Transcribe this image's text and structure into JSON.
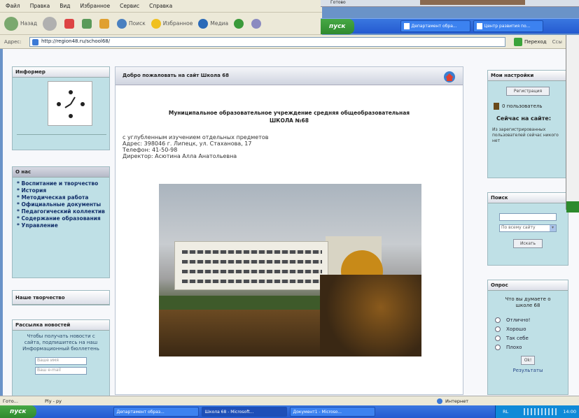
{
  "menu": [
    "Файл",
    "Правка",
    "Вид",
    "Избранное",
    "Сервис",
    "Справка"
  ],
  "toolbar": {
    "back": "Назад",
    "search": "Поиск",
    "favorites": "Избранное",
    "media": "Медиа"
  },
  "address": {
    "label": "Адрес:",
    "url": "http://region48.ru/school68/",
    "go": "Переход",
    "links": "Ссы"
  },
  "popup": {
    "title": "Готово"
  },
  "mini_taskbar": {
    "start": "пуск",
    "tasks": [
      "Департамент обра...",
      "Центр развития по..."
    ]
  },
  "breadcrumb": "",
  "informer": {
    "title": "Информер"
  },
  "about": {
    "title": "О нас",
    "links": [
      "* Воспитание и творчество",
      "* История",
      "* Методическая работа",
      "* Официальные документы",
      "* Педагогический коллектив",
      "* Содержание образования",
      "* Управление"
    ]
  },
  "creativity": {
    "title": "Наше творчество"
  },
  "news": {
    "title": "Рассылка новостей",
    "text": "Чтобы получать новости с сайта, подпишитесь на наш Информационный бюллетень",
    "name_placeholder": "Ваше имя",
    "email_placeholder": "Ваш e-mail"
  },
  "main": {
    "header": "Добро пожаловать на сайт Школа 68",
    "title_line1": "Муниципальное образовательное учреждение средняя общеобразовательная",
    "title_line2": "ШКОЛА №68",
    "line1": "с углубленным изучением отдельных предметов",
    "line2": "Адрес: 398046 г. Липецк, ул. Стаханова, 17",
    "line3": "Телефон: 41-50-98",
    "line4": "Директор: Асютина Алла Анатольевна"
  },
  "settings": {
    "title": "Мои настройки",
    "register": "Регистрация",
    "users": "0 пользователь",
    "online": "Сейчас на сайте:",
    "registered": "Из зарегистрированных пользователей сейчас никого нет"
  },
  "search": {
    "title": "Поиск",
    "scope": "По всему сайту",
    "button": "Искать"
  },
  "poll": {
    "title": "Опрос",
    "question": "Что вы думаете о школе 68",
    "options": [
      "Отлично!",
      "Хорошо",
      "Так себе",
      "Плохо"
    ],
    "vote": "Ok!",
    "results": "Результаты"
  },
  "status": {
    "left": "Гото...",
    "center": "Ply - py",
    "zone": "Интернет"
  },
  "taskbar": {
    "start": "пуск",
    "tasks": [
      "Департамент образ...",
      "Школа 68 - Microsoft...",
      "Документ1 - Microso..."
    ],
    "lang": "RL",
    "time": "14:00"
  }
}
